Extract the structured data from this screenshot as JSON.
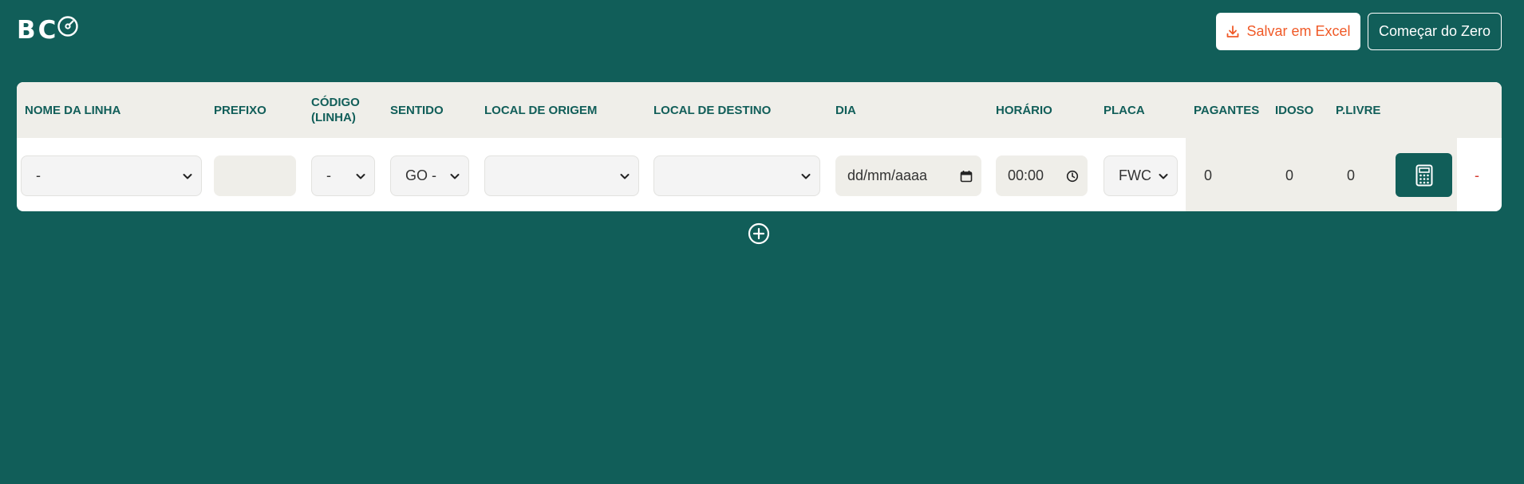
{
  "logo": {
    "text": "BC"
  },
  "header": {
    "excel_label": "Salvar em Excel",
    "reset_label": "Começar do Zero"
  },
  "table": {
    "columns": [
      "NOME DA LINHA",
      "PREFIXO",
      "CÓDIGO (LINHA)",
      "SENTIDO",
      "LOCAL DE ORIGEM",
      "LOCAL DE DESTINO",
      "DIA",
      "HORÁRIO",
      "PLACA",
      "PAGANTES",
      "IDOSO",
      "P.LIVRE"
    ],
    "row": {
      "nome_linha": "-",
      "prefixo": "",
      "codigo": "-",
      "sentido": "GO -",
      "origem": "",
      "destino": "",
      "dia": "dd/mm/aaaa",
      "horario": "00:00",
      "placa": "FWC",
      "pagantes": "0",
      "idoso": "0",
      "plivre": "0",
      "remove": "-"
    }
  },
  "icons": {
    "logo": "gauge-icon",
    "excel": "download-icon",
    "calculate": "calculator-icon",
    "add": "plus-circle-icon",
    "select": "chevron-down-icon",
    "date": "calendar-icon",
    "time": "clock-icon"
  },
  "colors": {
    "background": "#115e59",
    "accent_orange": "#f05a28",
    "header_beige": "#efeee9",
    "remove_red": "#d43a2f"
  }
}
